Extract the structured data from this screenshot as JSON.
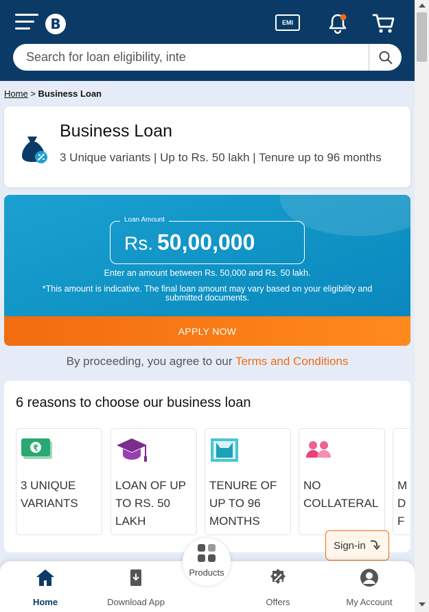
{
  "header": {
    "logo_text": "B",
    "emi_label": "EMI",
    "accent": "#0b3a66",
    "notification_dot": "#f26b10"
  },
  "search": {
    "placeholder": "Search for loan eligibility, inte"
  },
  "breadcrumb": {
    "home": "Home",
    "separator": ">",
    "current": "Business Loan"
  },
  "product": {
    "title": "Business Loan",
    "subtitle": "3 Unique variants | Up to Rs. 50 lakh | Tenure up to 96 months"
  },
  "loan_amount": {
    "label": "Loan Amount",
    "currency": "Rs.",
    "value": "50,00,000",
    "range_note": "Enter an amount between Rs. 50,000 and Rs. 50 lakh.",
    "disclaimer": "*This amount is indicative. The final loan amount may vary based on your eligibility and submitted documents.",
    "apply_label": "APPLY NOW"
  },
  "terms": {
    "prefix": "By proceeding, you agree to our",
    "link": "Terms and Conditions"
  },
  "reasons": {
    "title": "6 reasons to choose our business loan",
    "items": [
      {
        "text": "3 Unique variants",
        "icon": "rupee-note-icon"
      },
      {
        "text": "Loan of up to Rs. 50 Lakh",
        "icon": "graduation-cap-icon"
      },
      {
        "text": "Tenure of up to 96 months",
        "icon": "calendar-tenure-icon"
      },
      {
        "text": "No collateral",
        "icon": "people-icon"
      },
      {
        "text": "M D F",
        "icon": "partial-icon"
      }
    ]
  },
  "signin": {
    "label": "Sign-in"
  },
  "bottom_nav": {
    "home": "Home",
    "download": "Download App",
    "products": "Products",
    "offers": "Offers",
    "account": "My Account"
  }
}
